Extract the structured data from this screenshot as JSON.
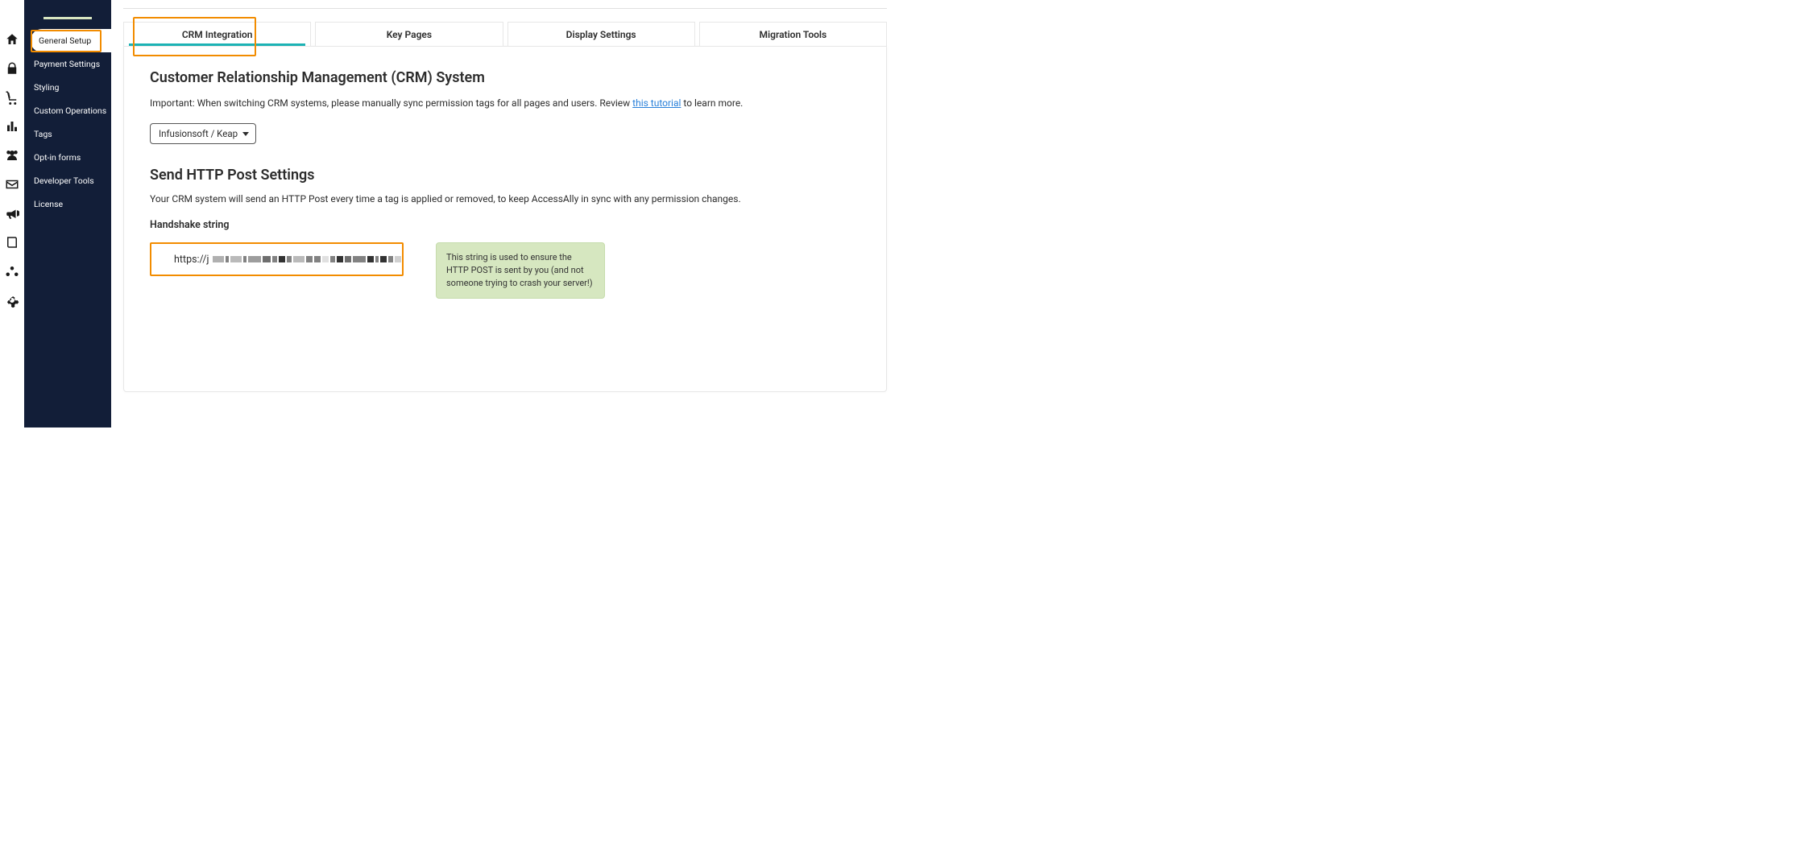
{
  "sidebar": {
    "items": [
      {
        "label": "General Setup",
        "active": true
      },
      {
        "label": "Payment Settings",
        "active": false
      },
      {
        "label": "Styling",
        "active": false
      },
      {
        "label": "Custom Operations",
        "active": false
      },
      {
        "label": "Tags",
        "active": false
      },
      {
        "label": "Opt-in forms",
        "active": false
      },
      {
        "label": "Developer Tools",
        "active": false
      },
      {
        "label": "License",
        "active": false
      }
    ]
  },
  "tabs": [
    {
      "label": "CRM Integration",
      "active": true
    },
    {
      "label": "Key Pages",
      "active": false
    },
    {
      "label": "Display Settings",
      "active": false
    },
    {
      "label": "Migration Tools",
      "active": false
    }
  ],
  "crm_section": {
    "title": "Customer Relationship Management (CRM) System",
    "important_prefix": "Important: When switching CRM systems, please manually sync permission tags for all pages and users. Review ",
    "tutorial_link": "this tutorial",
    "important_suffix": " to learn more.",
    "select_value": "Infusionsoft / Keap"
  },
  "http_post_section": {
    "title": "Send HTTP Post Settings",
    "description": "Your CRM system will send an HTTP Post every time a tag is applied or removed, to keep AccessAlly in sync with any permission changes.",
    "handshake_label": "Handshake string",
    "handshake_prefix": "https://j",
    "info_text": "This string is used to ensure the HTTP POST is sent by you (and not someone trying to crash your server!)"
  },
  "rail_icons": [
    "home-icon",
    "lock-icon",
    "cart-icon",
    "stats-icon",
    "users-icon",
    "mail-icon",
    "megaphone-icon",
    "book-icon",
    "cluster-icon",
    "gear-icon"
  ]
}
